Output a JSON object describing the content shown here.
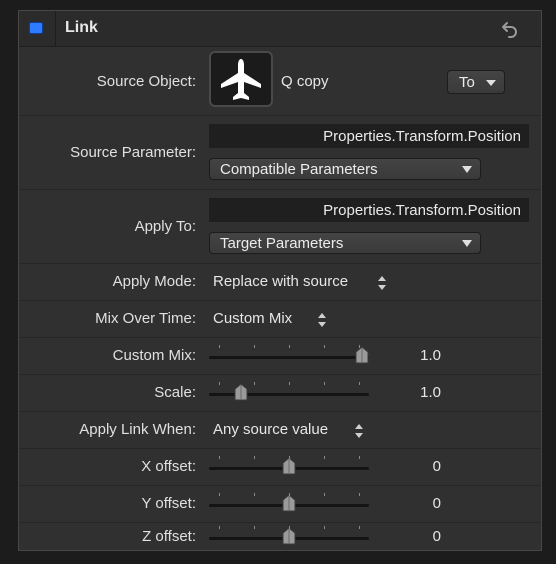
{
  "header": {
    "title": "Link",
    "enabled": true,
    "accent_color": "#2f7bff",
    "reset_icon": "reset-arrow-icon"
  },
  "source_object": {
    "label": "Source Object:",
    "icon": "airplane-icon",
    "name": "Q copy",
    "direction_popup": "To"
  },
  "source_parameter": {
    "label": "Source Parameter:",
    "path": "Properties.Transform.Position",
    "popup": "Compatible Parameters"
  },
  "apply_to": {
    "label": "Apply To:",
    "path": "Properties.Transform.Position",
    "popup": "Target Parameters"
  },
  "apply_mode": {
    "label": "Apply Mode:",
    "value": "Replace with source"
  },
  "mix_over_time": {
    "label": "Mix Over Time:",
    "value": "Custom Mix"
  },
  "custom_mix": {
    "label": "Custom Mix:",
    "value": "1.0",
    "slider_fraction": 1.0
  },
  "scale": {
    "label": "Scale:",
    "value": "1.0",
    "slider_fraction": 0.17
  },
  "apply_link_when": {
    "label": "Apply Link When:",
    "value": "Any source value"
  },
  "x_offset": {
    "label": "X offset:",
    "value": "0",
    "slider_fraction": 0.5
  },
  "y_offset": {
    "label": "Y offset:",
    "value": "0",
    "slider_fraction": 0.5
  },
  "z_offset": {
    "label": "Z offset:",
    "value": "0",
    "slider_fraction": 0.5
  }
}
